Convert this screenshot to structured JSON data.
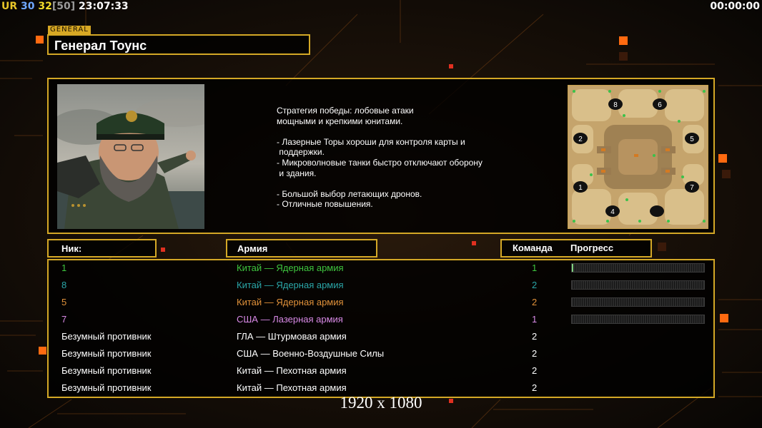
{
  "hud": {
    "ur": "UR",
    "val1": "30",
    "val2": "32",
    "val3": "[50]",
    "time": "23:07:33",
    "timer": "00:00:00"
  },
  "general": {
    "tag": "GENERAL",
    "name": "Генерал Тоунс"
  },
  "description": [
    "Стратегия победы: лобовые атаки",
    "мощными и крепкими юнитами.",
    "",
    "- Лазерные Торы хороши для контроля карты и",
    " поддержки.",
    "- Микроволновые танки быстро отключают оборону",
    " и здания.",
    "",
    "- Большой выбор летающих дронов.",
    "- Отличные повышения."
  ],
  "minimap": {
    "slots": [
      "8",
      "6",
      "2",
      "5",
      "1",
      "7",
      "4",
      ""
    ]
  },
  "headers": {
    "nick": "Ник:",
    "army": "Армия",
    "team": "Команда",
    "progress": "Прогресс"
  },
  "players": [
    {
      "nick": "1",
      "army": "Китай — Ядерная армия",
      "team": "1",
      "color": "#3fc63f",
      "progress": 0.01,
      "show_progress": true
    },
    {
      "nick": "8",
      "army": "Китай — Ядерная армия",
      "team": "2",
      "color": "#2aa6a8",
      "progress": 0,
      "show_progress": true
    },
    {
      "nick": "5",
      "army": "Китай — Ядерная армия",
      "team": "2",
      "color": "#e0913a",
      "progress": 0,
      "show_progress": true
    },
    {
      "nick": "7",
      "army": "США — Лазерная армия",
      "team": "1",
      "color": "#d98ae6",
      "progress": 0,
      "show_progress": true
    },
    {
      "nick": "Безумный противник",
      "army": "ГЛА — Штурмовая армия",
      "team": "2",
      "color": "#ffffff",
      "progress": 0,
      "show_progress": false
    },
    {
      "nick": "Безумный противник",
      "army": "США — Военно-Воздушные Силы",
      "team": "2",
      "color": "#ffffff",
      "progress": 0,
      "show_progress": false
    },
    {
      "nick": "Безумный противник",
      "army": "Китай — Пехотная армия",
      "team": "2",
      "color": "#ffffff",
      "progress": 0,
      "show_progress": false
    },
    {
      "nick": "Безумный противник",
      "army": "Китай — Пехотная армия",
      "team": "2",
      "color": "#ffffff",
      "progress": 0,
      "show_progress": false
    }
  ],
  "resolution": "1920 x 1080",
  "colors": {
    "frame": "#d4a826",
    "accent_orange": "#ff6a10"
  }
}
